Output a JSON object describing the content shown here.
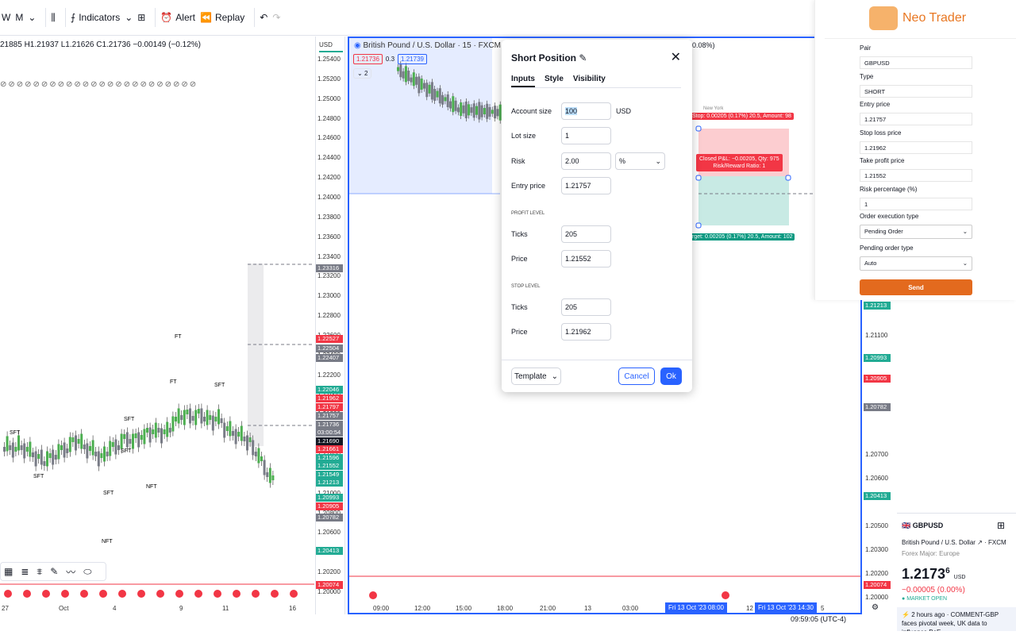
{
  "topbar": {
    "intervals": [
      "W",
      "M"
    ],
    "indicators": "Indicators",
    "alert": "Alert",
    "replay": "Replay"
  },
  "ohlc": "21885 H1.21937 L1.21626 C1.21736 −0.00149 (−0.12%)",
  "left_chart": {
    "currency": "USD",
    "price_ticks": [
      "1.25400",
      "1.25200",
      "1.25000",
      "1.24800",
      "1.24600",
      "1.24400",
      "1.24200",
      "1.24000",
      "1.23800",
      "1.23600",
      "1.23400",
      "1.23200",
      "1.23000",
      "1.22800",
      "1.22600",
      "1.22400",
      "1.22200",
      "1.22000",
      "1.21800",
      "1.21600",
      "1.21400",
      "1.21200",
      "1.21000",
      "1.20800",
      "1.20600",
      "1.20400",
      "1.20200",
      "1.20000"
    ],
    "price_labels": [
      {
        "v": "1.23316",
        "c": "#787b86"
      },
      {
        "v": "1.22527",
        "c": "#f23645"
      },
      {
        "v": "1.22504",
        "c": "#787b86"
      },
      {
        "v": "1.22407",
        "c": "#787b86"
      },
      {
        "v": "1.22046",
        "c": "#22ab94"
      },
      {
        "v": "1.21962",
        "c": "#f23645"
      },
      {
        "v": "1.21797",
        "c": "#f23645"
      },
      {
        "v": "1.21757",
        "c": "#787b86"
      },
      {
        "v": "1.21736",
        "c": "#787b86"
      },
      {
        "v": "03:00:54",
        "c": "#787b86"
      },
      {
        "v": "1.21690",
        "c": "#131722"
      },
      {
        "v": "1.21661",
        "c": "#f23645"
      },
      {
        "v": "1.21596",
        "c": "#22ab94"
      },
      {
        "v": "1.21552",
        "c": "#22ab94"
      },
      {
        "v": "1.21549",
        "c": "#22ab94"
      },
      {
        "v": "1.21213",
        "c": "#22ab94"
      },
      {
        "v": "1.20993",
        "c": "#22ab94"
      },
      {
        "v": "1.20905",
        "c": "#f23645"
      },
      {
        "v": "1.20782",
        "c": "#787b86"
      },
      {
        "v": "1.20413",
        "c": "#22ab94"
      },
      {
        "v": "1.20074",
        "c": "#f23645"
      }
    ],
    "x_labels": [
      "27",
      "Oct",
      "4",
      "9",
      "11",
      "16"
    ],
    "annotations": [
      "SFT",
      "SFT",
      "FT",
      "FT",
      "SFT",
      "SFT",
      "SFT",
      "NFT",
      "SFT",
      "NFT"
    ]
  },
  "right_chart": {
    "symbol": "British Pound / U.S. Dollar · 15 · FXCM",
    "bid": "1.21736",
    "spread": "0.3",
    "ask": "1.21739",
    "indicator_count": "2",
    "change_pct": "0.08%)",
    "price_ticks": [
      "1.21100",
      "1.20700",
      "1.20600",
      "1.20500",
      "1.20300",
      "1.20200",
      "1.20100",
      "1.20000"
    ],
    "price_labels": [
      {
        "v": "1.21213",
        "c": "#22ab94"
      },
      {
        "v": "1.20993",
        "c": "#22ab94"
      },
      {
        "v": "1.20905",
        "c": "#f23645"
      },
      {
        "v": "1.20782",
        "c": "#787b86"
      },
      {
        "v": "1.20413",
        "c": "#22ab94"
      },
      {
        "v": "1.20074",
        "c": "#f23645"
      }
    ],
    "x_labels": [
      "09:00",
      "12:00",
      "15:00",
      "18:00",
      "21:00",
      "13",
      "03:00",
      "12",
      "5"
    ],
    "date_badges": [
      "Fri 13 Oct '23   08:00",
      "Fri 13 Oct '23   14:30"
    ],
    "session_label": "New York",
    "stop_tag": "Stop: 0.00205 (0.17%) 20.5, Amount: 98",
    "pnl_tag_1": "Closed P&L: −0.00205, Qty: 975",
    "pnl_tag_2": "Risk/Reward Ratio: 1",
    "target_tag": "rget: 0.00205 (0.17%) 20.5, Amount: 102"
  },
  "dialog": {
    "title": "Short Position",
    "tabs": [
      "Inputs",
      "Style",
      "Visibility"
    ],
    "account_size_label": "Account size",
    "account_size": "100",
    "account_currency": "USD",
    "lot_size_label": "Lot size",
    "lot_size": "1",
    "risk_label": "Risk",
    "risk": "2.00",
    "risk_unit": "%",
    "entry_price_label": "Entry price",
    "entry_price": "1.21757",
    "profit_level": "PROFIT LEVEL",
    "stop_level": "STOP LEVEL",
    "ticks_label": "Ticks",
    "price_label": "Price",
    "profit_ticks": "205",
    "profit_price": "1.21552",
    "stop_ticks": "205",
    "stop_price": "1.21962",
    "template": "Template",
    "cancel": "Cancel",
    "ok": "Ok"
  },
  "neo_trader": {
    "brand": "Neo Trader",
    "fields": [
      {
        "label": "Pair",
        "value": "GBPUSD"
      },
      {
        "label": "Type",
        "value": "SHORT"
      },
      {
        "label": "Entry price",
        "value": "1.21757"
      },
      {
        "label": "Stop loss price",
        "value": "1.21962"
      },
      {
        "label": "Take profit price",
        "value": "1.21552"
      },
      {
        "label": "Risk percentage (%)",
        "value": "1"
      }
    ],
    "order_execution_label": "Order execution type",
    "order_execution": "Pending Order",
    "pending_type_label": "Pending order type",
    "pending_type": "Auto",
    "send": "Send"
  },
  "symbol_card": {
    "ticker": "GBPUSD",
    "name": "British Pound / U.S. Dollar",
    "exchange": "FXCM",
    "category": "Forex Major: Europe",
    "price": "1.2173",
    "price_sup": "6",
    "currency": "USD",
    "change": "−0.00005 (0.00%)",
    "status": "MARKET OPEN",
    "news_time": "2 hours ago",
    "news": "· COMMENT-GBP faces pivotal week, UK data to influence BoE"
  },
  "statusbar": {
    "time": "09:59:05 (UTC-4)"
  },
  "colors": {
    "accent": "#2962ff",
    "up": "#22ab94",
    "down": "#f23645",
    "brand": "#e36a1e"
  }
}
